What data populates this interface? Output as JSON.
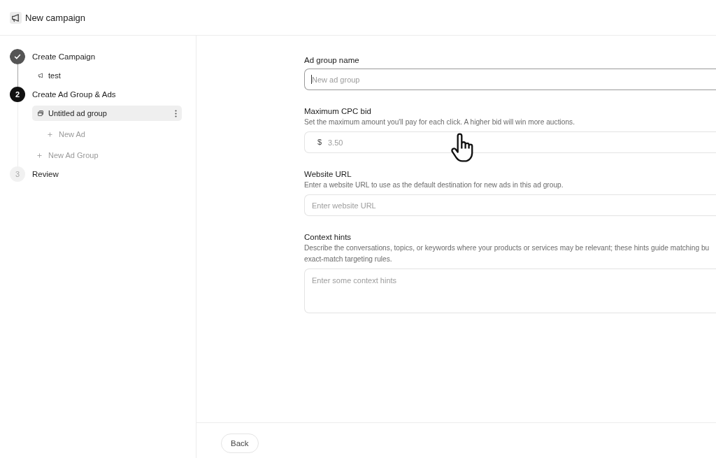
{
  "header": {
    "title": "New campaign"
  },
  "steps": [
    {
      "label": "Create Campaign",
      "completed": true,
      "selected": false,
      "children": [
        {
          "kind": "campaign",
          "label": "test",
          "selected": false
        }
      ]
    },
    {
      "number": "2",
      "label": "Create Ad Group & Ads",
      "completed": false,
      "selected": true,
      "children": [
        {
          "kind": "ad-group",
          "label": "Untitled ad group",
          "selected": true,
          "children": [
            {
              "kind": "add",
              "label": "New Ad",
              "selected": false
            }
          ]
        },
        {
          "kind": "add",
          "label": "New Ad Group",
          "selected": false
        }
      ]
    },
    {
      "number": "3",
      "label": "Review",
      "completed": false,
      "selected": false
    }
  ],
  "form": {
    "fields": [
      {
        "kind": "input",
        "label": "Ad group name",
        "placeholder": "New ad group",
        "focused": true
      },
      {
        "kind": "input",
        "label": "Maximum CPC bid",
        "help_lines": [
          "Set the maximum amount you'll pay for each click. A higher bid will win more auctions."
        ],
        "prefix": "$",
        "placeholder": "3.50",
        "focused": false
      },
      {
        "kind": "input",
        "label": "Website URL",
        "help_lines": [
          "Enter a website URL to use as the default destination for new ads in this ad group."
        ],
        "placeholder": "Enter website URL",
        "focused": false
      },
      {
        "kind": "textarea",
        "label": "Context hints",
        "help_lines": [
          "Describe the conversations, topics, or keywords where your products or services may be relevant; these hints guide matching bu",
          "exact-match targeting rules."
        ],
        "placeholder": "Enter some context hints",
        "focused": false
      }
    ]
  },
  "footer": {
    "back_label": "Back"
  }
}
